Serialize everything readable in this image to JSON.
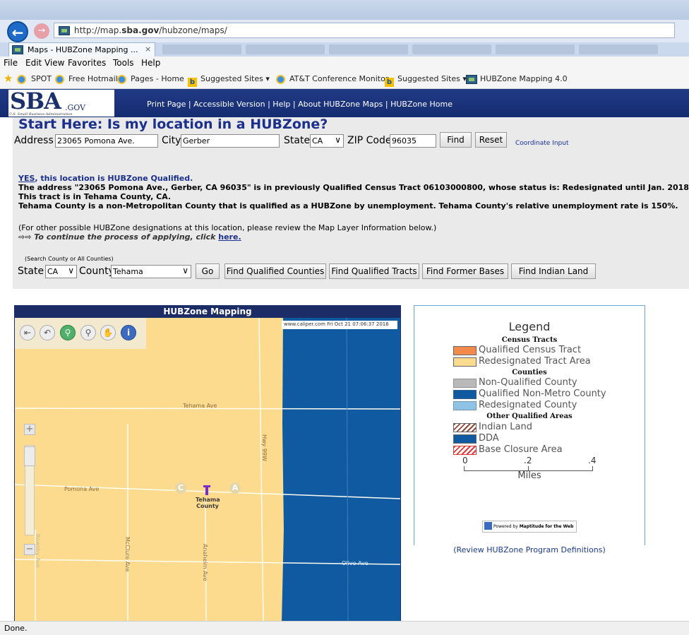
{
  "browser": {
    "url_prefix": "http://map.",
    "url_domain": "sba.gov",
    "url_path": "/hubzone/maps/",
    "tab_label": "Maps - HUBZone Mapping ...",
    "tab_close": "×",
    "menu": [
      "File",
      "Edit",
      "View",
      "Favorites",
      "Tools",
      "Help"
    ],
    "favorites": [
      "SPOT",
      "Free Hotmail",
      "Pages - Home",
      "Suggested Sites ▾",
      "AT&T Conference Monitor",
      "Suggested Sites ▾",
      "HUBZone Mapping 4.0"
    ],
    "status": "Done."
  },
  "sba": {
    "logo": "SBA",
    "logo_suffix": ".GOV",
    "logo_sub": "U.S. Small Business Administration",
    "links": "Print Page | Accessible Version | Help | About HUBZone Maps | HUBZone Home"
  },
  "search": {
    "title": "Start Here: Is my location in a HUBZone?",
    "address_label": "Address",
    "address_value": "23065 Pomona Ave.",
    "city_label": "City",
    "city_value": "Gerber",
    "state_label": "State",
    "state_value": "CA",
    "zip_label": "ZIP Code",
    "zip_value": "96035",
    "find": "Find",
    "reset": "Reset",
    "coordinate": "Coordinate Input"
  },
  "result": {
    "yes": "YES",
    "yes_rest": ", this location is HUBZone Qualified.",
    "line1": "The address \"23065 Pomona Ave., Gerber, CA 96035\" is in previously Qualified Census Tract 06103000800, whose status is: Redesignated until Jan. 2018.",
    "line2": "This tract is in Tehama County, CA.",
    "line3": "Tehama County is a non-Metropolitan County that is qualified as a HUBZone by unemployment. Tehama County's relative unemployment rate is 150%.",
    "other": "(For other possible HUBZone designations at this location, please review the Map Layer Information below.)",
    "cont_arrows": "⇨⇨",
    "cont_text": " To continue the process of applying, click ",
    "cont_link": "here."
  },
  "county_search": {
    "hint": "(Search County or All Counties)",
    "state_label": "State",
    "state_value": "CA",
    "county_label": "County",
    "county_value": "Tehama",
    "go": "Go",
    "buttons": [
      "Find Qualified Counties",
      "Find Qualified Tracts",
      "Find Former Bases",
      "Find Indian Land"
    ]
  },
  "map": {
    "title": "HUBZone Mapping",
    "stamp": "www.caliper.com Fri Oct 21 07:06:37 2016",
    "roads": {
      "tehama": "Tehama Ave",
      "pomona": "Pomona Ave",
      "hwy": "Hwy 99W",
      "mcclure": "McClure Ave",
      "anaheim": "Anaheim Ave",
      "olive": "Olive Ave",
      "rowsby": "Rowsby Ave"
    },
    "markers": [
      "C",
      "A"
    ],
    "county": "Tehama County",
    "colors": {
      "tract": "#fcdb8e",
      "county": "#0f5aa0"
    }
  },
  "legend": {
    "title": "Legend",
    "sections": [
      {
        "head": "Census Tracts",
        "items": [
          {
            "label": "Qualified Census Tract",
            "color": "#f28a4b"
          },
          {
            "label": "Redesignated Tract Area",
            "color": "#fcdb8e"
          }
        ]
      },
      {
        "head": "Counties",
        "items": [
          {
            "label": "Non-Qualified County",
            "color": "#b9b9b9"
          },
          {
            "label": "Qualified Non-Metro County",
            "color": "#0f5aa0"
          },
          {
            "label": "Redesignated County",
            "color": "#8fc3e6"
          }
        ]
      },
      {
        "head": "Other Qualified Areas",
        "items": [
          {
            "label": "Indian Land",
            "color": "#8b4a3a"
          },
          {
            "label": "DDA",
            "color": "#0f5aa0"
          },
          {
            "label": "Base Closure Area",
            "color": "#e03a3a"
          }
        ]
      }
    ],
    "scale": [
      "0",
      ".2",
      ".4"
    ],
    "scale_unit": "Miles",
    "powered_prefix": "Powered by ",
    "powered_brand": "Maptitude for the Web",
    "review": "(Review HUBZone Program Definitions)"
  }
}
